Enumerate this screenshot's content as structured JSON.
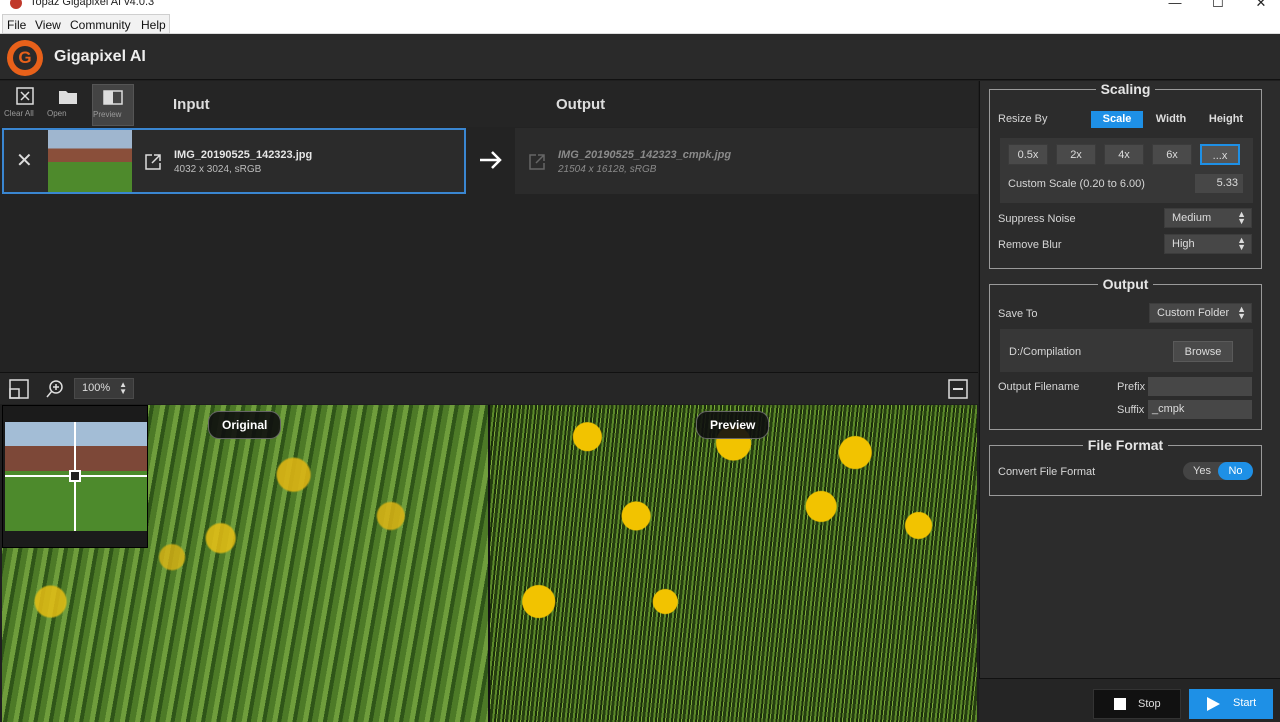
{
  "window": {
    "title": "Topaz Gigapixel AI v4.0.3",
    "minimize": "—",
    "maximize": "☐",
    "close": "✕"
  },
  "menu": {
    "file": "File",
    "view": "View",
    "community": "Community",
    "help": "Help"
  },
  "app": {
    "logo_letter": "G",
    "title": "Gigapixel AI"
  },
  "toolbar": {
    "clear_all": "Clear All",
    "open": "Open",
    "preview": "Preview"
  },
  "columns": {
    "input": "Input",
    "output": "Output"
  },
  "input_file": {
    "name": "IMG_20190525_142323.jpg",
    "meta": "4032 x 3024, sRGB"
  },
  "output_file": {
    "name": "IMG_20190525_142323_cmpk.jpg",
    "meta": "21504 x 16128, sRGB"
  },
  "view": {
    "zoom": "100%"
  },
  "panes": {
    "original_label": "Original",
    "preview_label": "Preview"
  },
  "scaling": {
    "title": "Scaling",
    "resize_by_label": "Resize By",
    "resize_options": [
      "Scale",
      "Width",
      "Height"
    ],
    "selected_resize": "Scale",
    "scale_presets": [
      "0.5x",
      "2x",
      "4x",
      "6x",
      "...x"
    ],
    "selected_preset": "...x",
    "custom_scale_label": "Custom Scale (0.20 to 6.00)",
    "custom_scale_value": "5.33",
    "suppress_noise_label": "Suppress Noise",
    "suppress_noise_value": "Medium",
    "remove_blur_label": "Remove Blur",
    "remove_blur_value": "High"
  },
  "output": {
    "title": "Output",
    "save_to_label": "Save To",
    "save_to_value": "Custom Folder",
    "folder_path": "D:/Compilation",
    "browse_label": "Browse",
    "filename_label": "Output Filename",
    "prefix_label": "Prefix",
    "prefix_value": "",
    "suffix_label": "Suffix",
    "suffix_value": "_cmpk"
  },
  "file_format": {
    "title": "File Format",
    "convert_label": "Convert File Format",
    "yes_label": "Yes",
    "no_label": "No",
    "selected": "No"
  },
  "actions": {
    "stop": "Stop",
    "start": "Start"
  },
  "colors": {
    "accent": "#1e90e6",
    "brand": "#e8611a",
    "panel_bg": "#2c2c2c"
  }
}
